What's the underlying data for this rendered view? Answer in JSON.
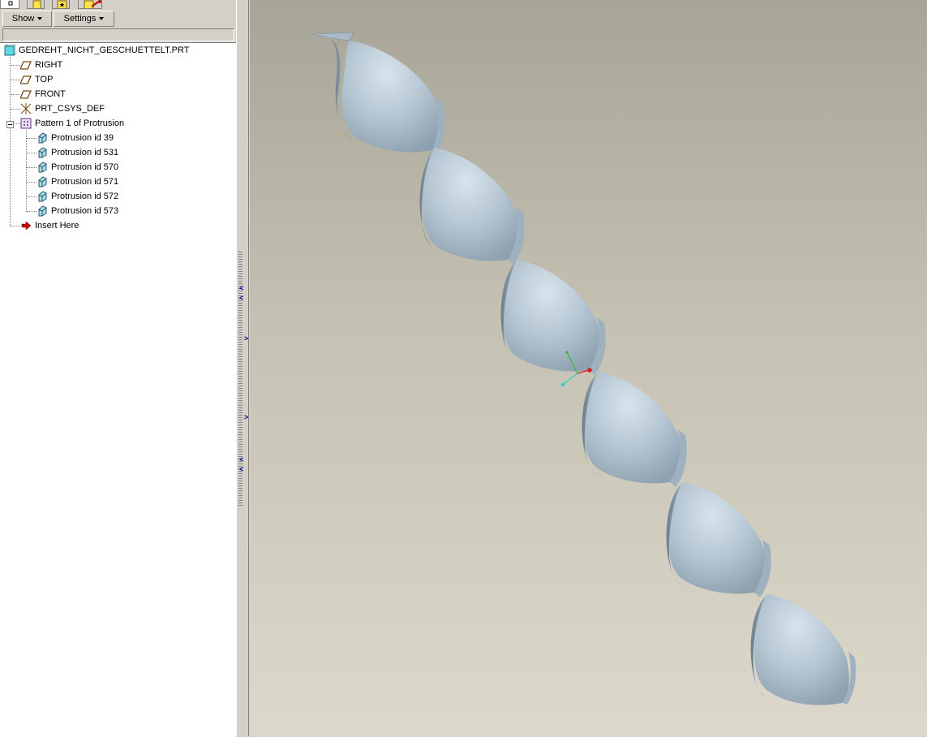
{
  "panel": {
    "tabs": [
      {
        "icon": "model-tree-tab-icon"
      },
      {
        "icon": "folder-browser-tab-icon"
      },
      {
        "icon": "favorites-tab-icon"
      },
      {
        "icon": "connections-tab-icon"
      }
    ],
    "toolbar": {
      "show_label": "Show",
      "settings_label": "Settings"
    }
  },
  "tree": {
    "root": {
      "label": "GEDREHT_NICHT_GESCHUETTELT.PRT",
      "icon": "part-icon"
    },
    "items": [
      {
        "label": "RIGHT",
        "icon": "datum-plane-icon"
      },
      {
        "label": "TOP",
        "icon": "datum-plane-icon"
      },
      {
        "label": "FRONT",
        "icon": "datum-plane-icon"
      },
      {
        "label": "PRT_CSYS_DEF",
        "icon": "coordinate-system-icon"
      },
      {
        "label": "Pattern 1 of Protrusion",
        "icon": "pattern-icon",
        "expanded": true,
        "children": [
          {
            "label": "Protrusion id 39",
            "icon": "protrusion-icon"
          },
          {
            "label": "Protrusion id 531",
            "icon": "protrusion-icon"
          },
          {
            "label": "Protrusion id 570",
            "icon": "protrusion-icon"
          },
          {
            "label": "Protrusion id 571",
            "icon": "protrusion-icon"
          },
          {
            "label": "Protrusion id 572",
            "icon": "protrusion-icon"
          },
          {
            "label": "Protrusion id 573",
            "icon": "protrusion-icon"
          }
        ]
      },
      {
        "label": "Insert Here",
        "icon": "insert-here-arrow-icon"
      }
    ]
  },
  "viewport": {
    "model": "twisted-helical-part",
    "segment_count": 6,
    "colors": {
      "background_top": "#a7a597",
      "background_bottom": "#dcd8cb",
      "part": "#b9c8d4"
    }
  }
}
